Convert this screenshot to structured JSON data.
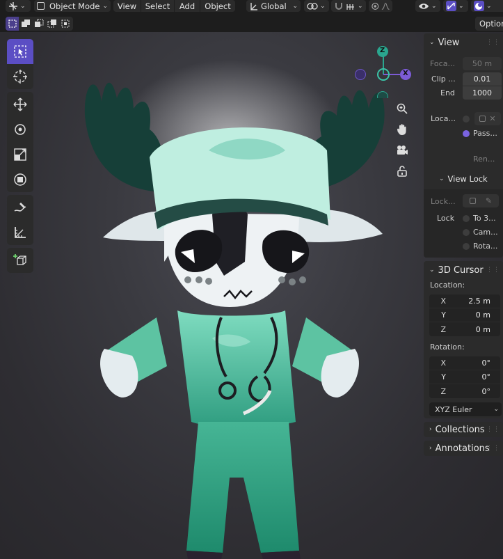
{
  "header": {
    "mode_label": "Object Mode",
    "menus": [
      "View",
      "Select",
      "Add",
      "Object"
    ],
    "transform_orientation": "Global"
  },
  "options_label": "Option",
  "colors": {
    "accent": "#5b4ec4",
    "panel": "#2b2b2b",
    "field": "#3d3d3d"
  },
  "gizmo": {
    "z": "Z",
    "x": "X"
  },
  "npanel": {
    "view": {
      "title": "View",
      "focal_label": "Foca...",
      "focal_value": "50 m",
      "clip_label": "Clip ...",
      "clip_start": "0.01",
      "end_label": "End",
      "clip_end": "1000",
      "local_label": "Loca...",
      "pass_label": "Pass...",
      "ren_label": "Ren...",
      "viewlock_title": "View Lock",
      "lock_obj_label": "Lock...",
      "lock_label": "Lock",
      "to3d_label": "To 3...",
      "cam_label": "Cam...",
      "rota_label": "Rota..."
    },
    "cursor": {
      "title": "3D Cursor",
      "location_label": "Location:",
      "loc": [
        {
          "axis": "X",
          "value": "2.5 m"
        },
        {
          "axis": "Y",
          "value": "0 m"
        },
        {
          "axis": "Z",
          "value": "0 m"
        }
      ],
      "rotation_label": "Rotation:",
      "rot": [
        {
          "axis": "X",
          "value": "0°"
        },
        {
          "axis": "Y",
          "value": "0°"
        },
        {
          "axis": "Z",
          "value": "0°"
        }
      ],
      "euler_mode": "XYZ Euler"
    },
    "collections_title": "Collections",
    "annotations_title": "Annotations"
  }
}
